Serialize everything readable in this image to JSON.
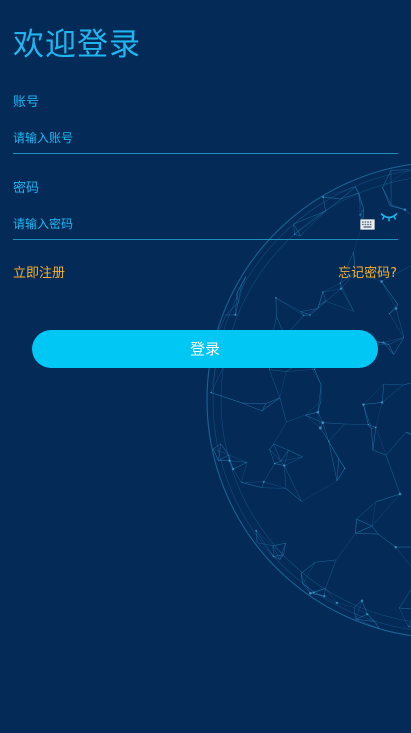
{
  "header": {
    "title": "欢迎登录"
  },
  "form": {
    "account_label": "账号",
    "account_placeholder": "请输入账号",
    "account_value": "",
    "password_label": "密码",
    "password_placeholder": "请输入密码",
    "password_value": ""
  },
  "links": {
    "register": "立即注册",
    "forgot": "忘记密码?"
  },
  "actions": {
    "login_label": "登录"
  },
  "icons": {
    "keyboard": "keyboard-icon",
    "visibility": "eye-closed-icon",
    "background": "globe-network-illustration"
  },
  "colors": {
    "background": "#042a58",
    "accent": "#1fb6ef",
    "link": "#f7b22a",
    "button": "#00c7f4",
    "button_text": "#ffffff"
  }
}
